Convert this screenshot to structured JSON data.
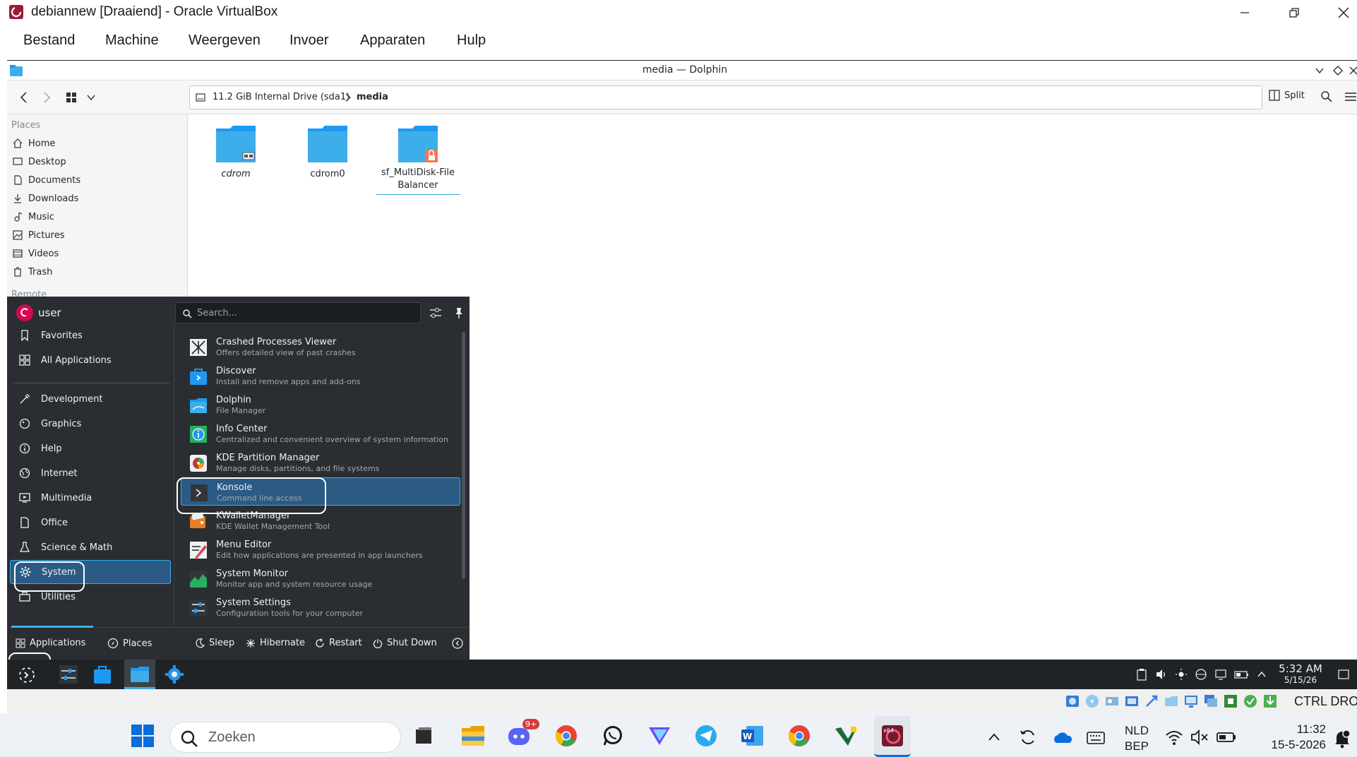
{
  "vbox": {
    "title": "debiannew [Draaiend] - Oracle VirtualBox",
    "menu": [
      "Bestand",
      "Machine",
      "Weergeven",
      "Invoer",
      "Apparaten",
      "Hulp"
    ],
    "status_right": "CTRL DROITE"
  },
  "dolphin": {
    "window_title": "media — Dolphin",
    "split_label": "Split",
    "breadcrumb": {
      "drive": "11.2 GiB Internal Drive (sda1)",
      "current": "media"
    },
    "places_header": "Places",
    "places": [
      {
        "label": "Home",
        "icon": "home-icon"
      },
      {
        "label": "Desktop",
        "icon": "desktop-icon"
      },
      {
        "label": "Documents",
        "icon": "documents-icon"
      },
      {
        "label": "Downloads",
        "icon": "downloads-icon"
      },
      {
        "label": "Music",
        "icon": "music-icon"
      },
      {
        "label": "Pictures",
        "icon": "pictures-icon"
      },
      {
        "label": "Videos",
        "icon": "videos-icon"
      },
      {
        "label": "Trash",
        "icon": "trash-icon"
      }
    ],
    "remote_header": "Remote",
    "folders": [
      {
        "name": "cdrom"
      },
      {
        "name": "cdrom0"
      },
      {
        "name_line1": "sf_MultiDisk-File",
        "name_line2": "Balancer"
      }
    ]
  },
  "kickoff": {
    "user": "user",
    "search_placeholder": "Search...",
    "categories": [
      {
        "label": "Favorites",
        "icon": "bookmark-icon"
      },
      {
        "label": "All Applications",
        "icon": "grid-icon"
      },
      {
        "label": "Development",
        "icon": "development-icon"
      },
      {
        "label": "Graphics",
        "icon": "graphics-icon"
      },
      {
        "label": "Help",
        "icon": "help-icon"
      },
      {
        "label": "Internet",
        "icon": "globe-icon"
      },
      {
        "label": "Multimedia",
        "icon": "multimedia-icon"
      },
      {
        "label": "Office",
        "icon": "office-icon"
      },
      {
        "label": "Science & Math",
        "icon": "flask-icon"
      },
      {
        "label": "System",
        "icon": "gear-icon"
      },
      {
        "label": "Utilities",
        "icon": "utilities-icon"
      }
    ],
    "selected_category": "System",
    "apps": [
      {
        "name": "Crashed Processes Viewer",
        "desc": "Offers detailed view of past crashes",
        "icon": "crash-icon"
      },
      {
        "name": "Discover",
        "desc": "Install and remove apps and add-ons",
        "icon": "discover-icon"
      },
      {
        "name": "Dolphin",
        "desc": "File Manager",
        "icon": "dolphin-icon"
      },
      {
        "name": "Info Center",
        "desc": "Centralized and convenient overview of system information",
        "icon": "info-icon"
      },
      {
        "name": "KDE Partition Manager",
        "desc": "Manage disks, partitions, and file systems",
        "icon": "partition-icon"
      },
      {
        "name": "Konsole",
        "desc": "Command line access",
        "icon": "terminal-icon"
      },
      {
        "name": "KWalletManager",
        "desc": "KDE Wallet Management Tool",
        "icon": "wallet-icon"
      },
      {
        "name": "Menu Editor",
        "desc": "Edit how applications are presented in app launchers",
        "icon": "menu-editor-icon"
      },
      {
        "name": "System Monitor",
        "desc": "Monitor app and system resource usage",
        "icon": "monitor-icon"
      },
      {
        "name": "System Settings",
        "desc": "Configuration tools for your computer",
        "icon": "settings-icon"
      }
    ],
    "selected_app": "Konsole",
    "footer": {
      "applications": "Applications",
      "places": "Places",
      "sleep": "Sleep",
      "hibernate": "Hibernate",
      "restart": "Restart",
      "shutdown": "Shut Down"
    }
  },
  "plasma_panel": {
    "time": "5:32 AM",
    "date": "5/15/26"
  },
  "windows_taskbar": {
    "search": "Zoeken",
    "discord_badge": "9+",
    "language": "NLD",
    "layout": "BEP",
    "time": "11:32",
    "date": "15-5-2026"
  },
  "colors": {
    "kickoff_bg": "#2a2e32",
    "selection": "#2b5a85",
    "selection_border": "#3daee9",
    "folder": "#3daee9",
    "debian_red": "#d70751"
  }
}
